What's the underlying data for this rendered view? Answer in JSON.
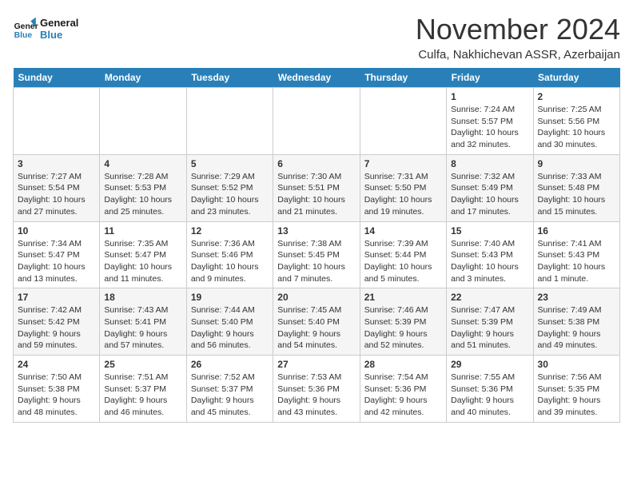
{
  "logo": {
    "text_general": "General",
    "text_blue": "Blue"
  },
  "title": "November 2024",
  "location": "Culfa, Nakhichevan ASSR, Azerbaijan",
  "days_header": [
    "Sunday",
    "Monday",
    "Tuesday",
    "Wednesday",
    "Thursday",
    "Friday",
    "Saturday"
  ],
  "weeks": [
    [
      {
        "day": "",
        "info": ""
      },
      {
        "day": "",
        "info": ""
      },
      {
        "day": "",
        "info": ""
      },
      {
        "day": "",
        "info": ""
      },
      {
        "day": "",
        "info": ""
      },
      {
        "day": "1",
        "info": "Sunrise: 7:24 AM\nSunset: 5:57 PM\nDaylight: 10 hours and 32 minutes."
      },
      {
        "day": "2",
        "info": "Sunrise: 7:25 AM\nSunset: 5:56 PM\nDaylight: 10 hours and 30 minutes."
      }
    ],
    [
      {
        "day": "3",
        "info": "Sunrise: 7:27 AM\nSunset: 5:54 PM\nDaylight: 10 hours and 27 minutes."
      },
      {
        "day": "4",
        "info": "Sunrise: 7:28 AM\nSunset: 5:53 PM\nDaylight: 10 hours and 25 minutes."
      },
      {
        "day": "5",
        "info": "Sunrise: 7:29 AM\nSunset: 5:52 PM\nDaylight: 10 hours and 23 minutes."
      },
      {
        "day": "6",
        "info": "Sunrise: 7:30 AM\nSunset: 5:51 PM\nDaylight: 10 hours and 21 minutes."
      },
      {
        "day": "7",
        "info": "Sunrise: 7:31 AM\nSunset: 5:50 PM\nDaylight: 10 hours and 19 minutes."
      },
      {
        "day": "8",
        "info": "Sunrise: 7:32 AM\nSunset: 5:49 PM\nDaylight: 10 hours and 17 minutes."
      },
      {
        "day": "9",
        "info": "Sunrise: 7:33 AM\nSunset: 5:48 PM\nDaylight: 10 hours and 15 minutes."
      }
    ],
    [
      {
        "day": "10",
        "info": "Sunrise: 7:34 AM\nSunset: 5:47 PM\nDaylight: 10 hours and 13 minutes."
      },
      {
        "day": "11",
        "info": "Sunrise: 7:35 AM\nSunset: 5:47 PM\nDaylight: 10 hours and 11 minutes."
      },
      {
        "day": "12",
        "info": "Sunrise: 7:36 AM\nSunset: 5:46 PM\nDaylight: 10 hours and 9 minutes."
      },
      {
        "day": "13",
        "info": "Sunrise: 7:38 AM\nSunset: 5:45 PM\nDaylight: 10 hours and 7 minutes."
      },
      {
        "day": "14",
        "info": "Sunrise: 7:39 AM\nSunset: 5:44 PM\nDaylight: 10 hours and 5 minutes."
      },
      {
        "day": "15",
        "info": "Sunrise: 7:40 AM\nSunset: 5:43 PM\nDaylight: 10 hours and 3 minutes."
      },
      {
        "day": "16",
        "info": "Sunrise: 7:41 AM\nSunset: 5:43 PM\nDaylight: 10 hours and 1 minute."
      }
    ],
    [
      {
        "day": "17",
        "info": "Sunrise: 7:42 AM\nSunset: 5:42 PM\nDaylight: 9 hours and 59 minutes."
      },
      {
        "day": "18",
        "info": "Sunrise: 7:43 AM\nSunset: 5:41 PM\nDaylight: 9 hours and 57 minutes."
      },
      {
        "day": "19",
        "info": "Sunrise: 7:44 AM\nSunset: 5:40 PM\nDaylight: 9 hours and 56 minutes."
      },
      {
        "day": "20",
        "info": "Sunrise: 7:45 AM\nSunset: 5:40 PM\nDaylight: 9 hours and 54 minutes."
      },
      {
        "day": "21",
        "info": "Sunrise: 7:46 AM\nSunset: 5:39 PM\nDaylight: 9 hours and 52 minutes."
      },
      {
        "day": "22",
        "info": "Sunrise: 7:47 AM\nSunset: 5:39 PM\nDaylight: 9 hours and 51 minutes."
      },
      {
        "day": "23",
        "info": "Sunrise: 7:49 AM\nSunset: 5:38 PM\nDaylight: 9 hours and 49 minutes."
      }
    ],
    [
      {
        "day": "24",
        "info": "Sunrise: 7:50 AM\nSunset: 5:38 PM\nDaylight: 9 hours and 48 minutes."
      },
      {
        "day": "25",
        "info": "Sunrise: 7:51 AM\nSunset: 5:37 PM\nDaylight: 9 hours and 46 minutes."
      },
      {
        "day": "26",
        "info": "Sunrise: 7:52 AM\nSunset: 5:37 PM\nDaylight: 9 hours and 45 minutes."
      },
      {
        "day": "27",
        "info": "Sunrise: 7:53 AM\nSunset: 5:36 PM\nDaylight: 9 hours and 43 minutes."
      },
      {
        "day": "28",
        "info": "Sunrise: 7:54 AM\nSunset: 5:36 PM\nDaylight: 9 hours and 42 minutes."
      },
      {
        "day": "29",
        "info": "Sunrise: 7:55 AM\nSunset: 5:36 PM\nDaylight: 9 hours and 40 minutes."
      },
      {
        "day": "30",
        "info": "Sunrise: 7:56 AM\nSunset: 5:35 PM\nDaylight: 9 hours and 39 minutes."
      }
    ]
  ]
}
